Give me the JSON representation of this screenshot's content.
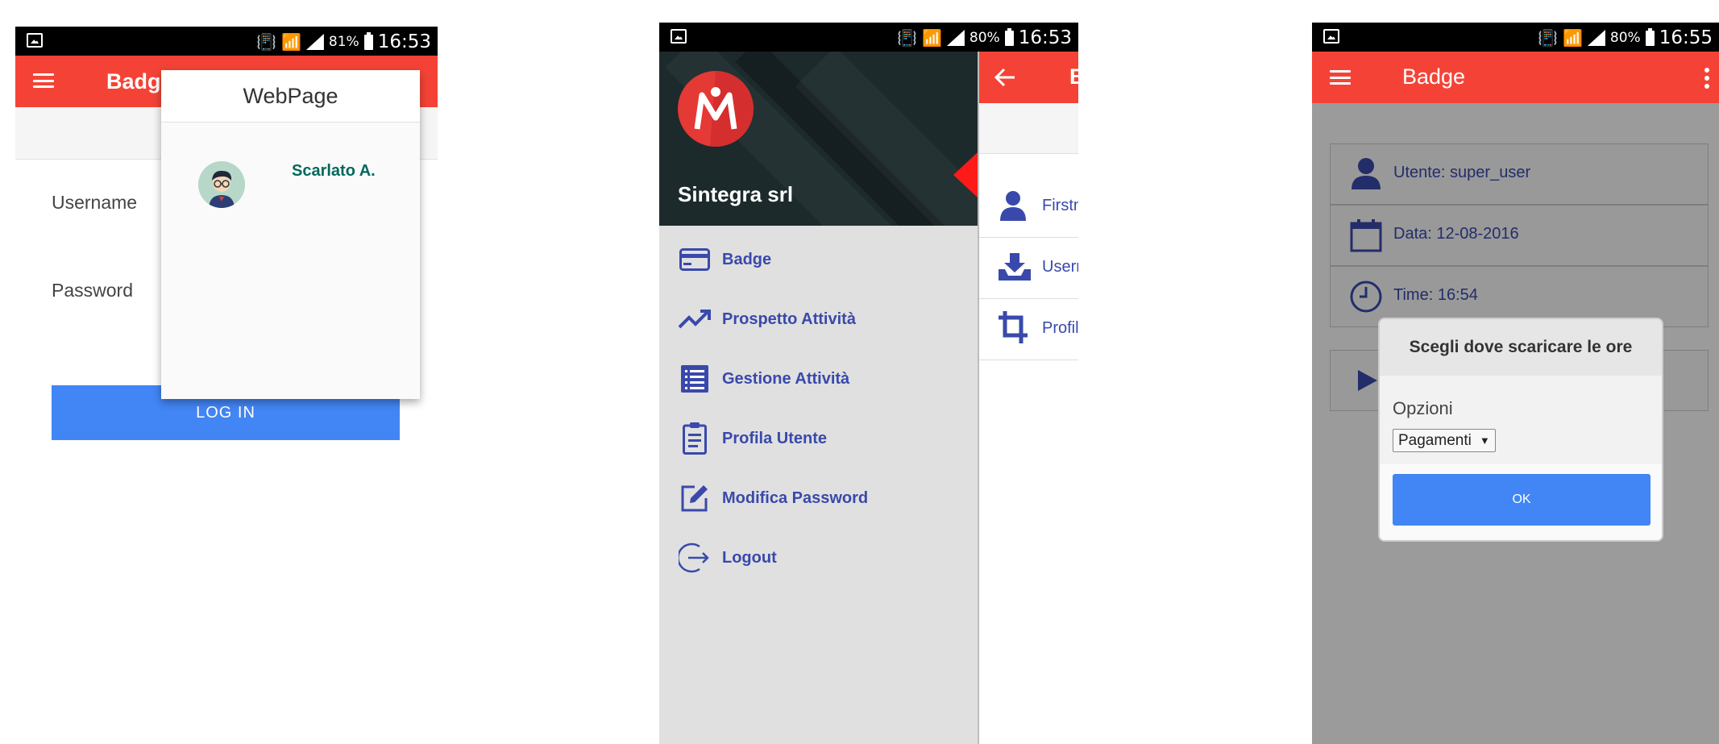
{
  "screen1": {
    "status": {
      "battery": "81%",
      "time": "16:53"
    },
    "appbar_title": "Badge",
    "username_label": "Username",
    "password_label": "Password",
    "login_label": "LOG IN",
    "popup": {
      "title": "WebPage",
      "user_name": "Scarlato A."
    }
  },
  "screen2": {
    "status": {
      "battery": "80%",
      "time": "16:53"
    },
    "company": "Sintegra srl",
    "behind_title_partial": "B",
    "menu": [
      {
        "label": "Badge",
        "icon": "credit-card-icon"
      },
      {
        "label": "Prospetto Attività",
        "icon": "trending-up-icon"
      },
      {
        "label": "Gestione Attività",
        "icon": "list-icon"
      },
      {
        "label": "Profila Utente",
        "icon": "clipboard-icon"
      },
      {
        "label": "Modifica Password",
        "icon": "edit-icon"
      },
      {
        "label": "Logout",
        "icon": "logout-icon"
      }
    ],
    "behind_rows": [
      "Firstn",
      "Usern",
      "Profil"
    ]
  },
  "screen3": {
    "status": {
      "battery": "80%",
      "time": "16:55"
    },
    "appbar_title": "Badge",
    "info": {
      "utente": "Utente: super_user",
      "data": "Data: 12-08-2016",
      "time": "Time: 16:54"
    },
    "dialog": {
      "title": "Scegli dove scaricare le ore",
      "label": "Opzioni",
      "selected": "Pagamenti",
      "ok_label": "OK"
    }
  },
  "colors": {
    "appbar": "#f44336",
    "primary_button": "#4285f4",
    "accent_text": "#3949ab",
    "name_text": "#00695c"
  }
}
